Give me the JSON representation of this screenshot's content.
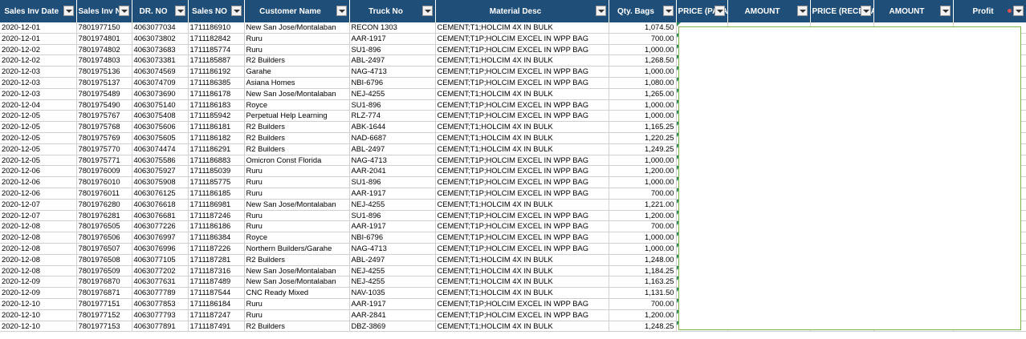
{
  "columns": [
    {
      "label": "Sales Inv Date",
      "width": 95
    },
    {
      "label": "Sales Inv No",
      "width": 69
    },
    {
      "label": "DR. NO",
      "width": 70
    },
    {
      "label": "Sales NO",
      "width": 70
    },
    {
      "label": "Customer Name",
      "width": 131
    },
    {
      "label": "Truck No",
      "width": 107
    },
    {
      "label": "Material Desc",
      "width": 216
    },
    {
      "label": "Qty. Bags",
      "width": 84
    },
    {
      "label": "PRICE (PAYABLE",
      "width": 64
    },
    {
      "label": "AMOUNT",
      "width": 103
    },
    {
      "label": "PRICE (RECEIVABLE",
      "width": 79
    },
    {
      "label": "AMOUNT",
      "width": 99
    },
    {
      "label": "Profit",
      "width": 91
    }
  ],
  "sorted_column_index": 12,
  "rows": [
    [
      "2020-12-01",
      "7801977150",
      "4063077034",
      "1711186910",
      " New San Jose/Montalaban",
      "RECON 1303",
      "CEMENT;T1;HOLCIM 4X IN BULK",
      "1,074.50"
    ],
    [
      "2020-12-01",
      "7801974801",
      "4063073802",
      "1711182842",
      "Ruru",
      "AAR-1917",
      "CEMENT;T1P;HOLCIM EXCEL IN WPP BAG",
      "700.00"
    ],
    [
      "2020-12-02",
      "7801974802",
      "4063073683",
      "1711185774",
      "Ruru",
      "SU1-896",
      "CEMENT;T1P;HOLCIM EXCEL IN WPP BAG",
      "1,000.00"
    ],
    [
      "2020-12-02",
      "7801974803",
      "4063073381",
      "1711185887",
      "R2 Builders",
      "ABL-2497",
      "CEMENT;T1;HOLCIM 4X IN BULK",
      "1,268.50"
    ],
    [
      "2020-12-03",
      "7801975136",
      "4063074569",
      "1711186192",
      "Garahe",
      "NAG-4713",
      "CEMENT;T1P;HOLCIM EXCEL IN WPP BAG",
      "1,000.00"
    ],
    [
      "2020-12-03",
      "7801975137",
      "4063074709",
      "1711186385",
      "Asiana Homes",
      "NBI-6796",
      "CEMENT;T1P;HOLCIM EXCEL IN WPP BAG",
      "1,080.00"
    ],
    [
      "2020-12-03",
      "7801975489",
      "4063073690",
      "1711186178",
      "New San Jose/Montalaban",
      "NEJ-4255",
      "CEMENT;T1;HOLCIM 4X IN BULK",
      "1,265.00"
    ],
    [
      "2020-12-04",
      "7801975490",
      "4063075140",
      "1711186183",
      "Royce",
      "SU1-896",
      "CEMENT;T1P;HOLCIM EXCEL IN WPP BAG",
      "1,000.00"
    ],
    [
      "2020-12-05",
      "7801975767",
      "4063075408",
      "1711185942",
      "Perpetual Help Learning",
      "RLZ-774",
      "CEMENT;T1P;HOLCIM EXCEL IN WPP BAG",
      "1,000.00"
    ],
    [
      "2020-12-05",
      "7801975768",
      "4063075606",
      "1711186181",
      "R2 Builders",
      "ABK-1644",
      "CEMENT;T1;HOLCIM 4X IN BULK",
      "1,165.25"
    ],
    [
      "2020-12-05",
      "7801975769",
      "4063075605",
      "1711186182",
      "R2 Builders",
      "NAD-6687",
      "CEMENT;T1;HOLCIM 4X IN BULK",
      "1,220.25"
    ],
    [
      "2020-12-05",
      "7801975770",
      "4063074474",
      "1711186291",
      "R2 Builders",
      "ABL-2497",
      "CEMENT;T1;HOLCIM 4X IN BULK",
      "1,249.25"
    ],
    [
      "2020-12-05",
      "7801975771",
      "4063075586",
      "1711186883",
      "Omicron Const Florida",
      "NAG-4713",
      "CEMENT;T1P;HOLCIM EXCEL IN WPP BAG",
      "1,000.00"
    ],
    [
      "2020-12-06",
      "7801976009",
      "4063075927",
      "1711185039",
      "Ruru",
      "AAR-2041",
      "CEMENT;T1P;HOLCIM EXCEL IN WPP BAG",
      "1,200.00"
    ],
    [
      "2020-12-06",
      "7801976010",
      "4063075908",
      "1711185775",
      "Ruru",
      "SU1-896",
      "CEMENT;T1P;HOLCIM EXCEL IN WPP BAG",
      "1,000.00"
    ],
    [
      "2020-12-06",
      "7801976011",
      "4063076125",
      "1711186185",
      "Ruru",
      "AAR-1917",
      "CEMENT;T1P;HOLCIM EXCEL IN WPP BAG",
      "700.00"
    ],
    [
      "2020-12-07",
      "7801976280",
      "4063076618",
      "1711186981",
      "New San Jose/Montalaban",
      "NEJ-4255",
      "CEMENT;T1;HOLCIM 4X IN BULK",
      "1,221.00"
    ],
    [
      "2020-12-07",
      "7801976281",
      "4063076681",
      "1711187246",
      "Ruru",
      "SU1-896",
      "CEMENT;T1P;HOLCIM EXCEL IN WPP BAG",
      "1,200.00"
    ],
    [
      "2020-12-08",
      "7801976505",
      "4063077226",
      "1711186186",
      "Ruru",
      "AAR-1917",
      "CEMENT;T1P;HOLCIM EXCEL IN WPP BAG",
      "700.00"
    ],
    [
      "2020-12-08",
      "7801976506",
      "4063076997",
      "1711186384",
      "Royce",
      "NBI-6796",
      "CEMENT;T1P;HOLCIM EXCEL IN WPP BAG",
      "1,000.00"
    ],
    [
      "2020-12-08",
      "7801976507",
      "4063076996",
      "1711187226",
      "Northern Builders/Garahe",
      "NAG-4713",
      "CEMENT;T1P;HOLCIM EXCEL IN WPP BAG",
      "1,000.00"
    ],
    [
      "2020-12-08",
      "7801976508",
      "4063077105",
      "1711187281",
      "R2 Builders",
      "ABL-2497",
      "CEMENT;T1;HOLCIM 4X IN BULK",
      "1,248.00"
    ],
    [
      "2020-12-08",
      "7801976509",
      "4063077202",
      "1711187316",
      "New San Jose/Montalaban",
      "NEJ-4255",
      "CEMENT;T1;HOLCIM 4X IN BULK",
      "1,184.25"
    ],
    [
      "2020-12-09",
      "7801976870",
      "4063077631",
      "1711187489",
      "New San Jose/Montalaban",
      "NEJ-4255",
      "CEMENT;T1;HOLCIM 4X IN BULK",
      "1,163.25"
    ],
    [
      "2020-12-09",
      "7801976871",
      "4063077789",
      "1711187544",
      "CNC Ready Mixed",
      "NAV-1035",
      "CEMENT;T1;HOLCIM 4X IN BULK",
      "1,131.50"
    ],
    [
      "2020-12-10",
      "7801977151",
      "4063077853",
      "1711186184",
      "Ruru",
      "AAR-1917",
      "CEMENT;T1P;HOLCIM EXCEL IN WPP BAG",
      "700.00"
    ],
    [
      "2020-12-10",
      "7801977152",
      "4063077793",
      "1711187247",
      "Ruru",
      "AAR-2841",
      "CEMENT;T1P;HOLCIM EXCEL IN WPP BAG",
      "1,200.00"
    ],
    [
      "2020-12-10",
      "7801977153",
      "4063077891",
      "1711187491",
      "R2 Builders",
      "DBZ-3869",
      "CEMENT;T1;HOLCIM 4X IN BULK",
      "1,248.25"
    ]
  ]
}
